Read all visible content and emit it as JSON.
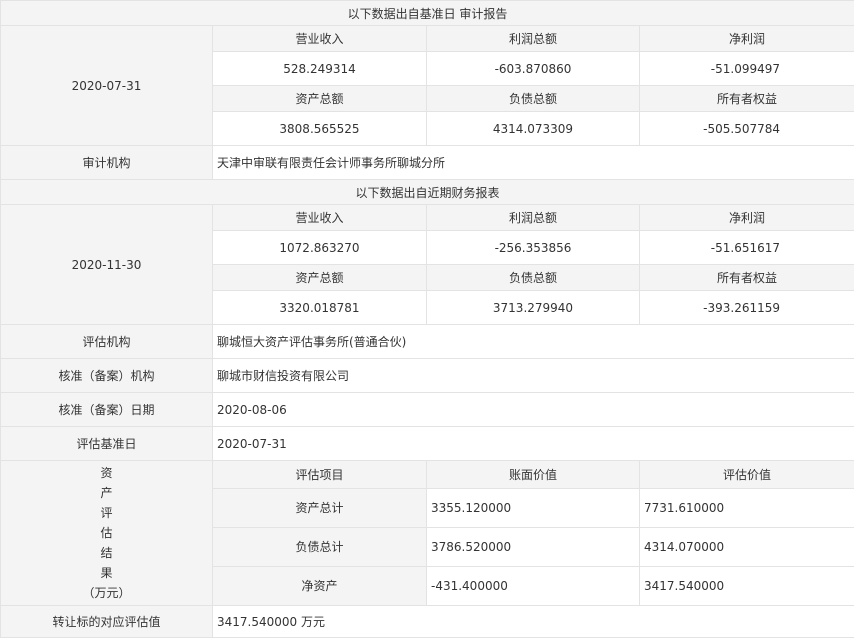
{
  "audit": {
    "section_title": "以下数据出自基准日 审计报告",
    "date": "2020-07-31",
    "headers1": [
      "营业收入",
      "利润总额",
      "净利润"
    ],
    "values1": [
      "528.249314",
      "-603.870860",
      "-51.099497"
    ],
    "headers2": [
      "资产总额",
      "负债总额",
      "所有者权益"
    ],
    "values2": [
      "3808.565525",
      "4314.073309",
      "-505.507784"
    ],
    "agency_label": "审计机构",
    "agency_value": "天津中审联有限责任会计师事务所聊城分所"
  },
  "recent": {
    "section_title": "以下数据出自近期财务报表",
    "date": "2020-11-30",
    "headers1": [
      "营业收入",
      "利润总额",
      "净利润"
    ],
    "values1": [
      "1072.863270",
      "-256.353856",
      "-51.651617"
    ],
    "headers2": [
      "资产总额",
      "负债总额",
      "所有者权益"
    ],
    "values2": [
      "3320.018781",
      "3713.279940",
      "-393.261159"
    ]
  },
  "info_rows": [
    {
      "label": "评估机构",
      "value": "聊城恒大资产评估事务所(普通合伙)"
    },
    {
      "label": "核准（备案）机构",
      "value": "聊城市财信投资有限公司"
    },
    {
      "label": "核准（备案）日期",
      "value": "2020-08-06"
    },
    {
      "label": "评估基准日",
      "value": "2020-07-31"
    }
  ],
  "valuation": {
    "vertical_label": [
      "资",
      "产",
      "评",
      "估",
      "结",
      "果",
      "（万元）"
    ],
    "headers": [
      "评估项目",
      "账面价值",
      "评估价值"
    ],
    "rows": [
      [
        "资产总计",
        "3355.120000",
        "7731.610000"
      ],
      [
        "负债总计",
        "3786.520000",
        "4314.070000"
      ],
      [
        "净资产",
        "-431.400000",
        "3417.540000"
      ]
    ]
  },
  "transfer": {
    "label": "转让标的对应评估值",
    "value": "3417.540000 万元"
  }
}
